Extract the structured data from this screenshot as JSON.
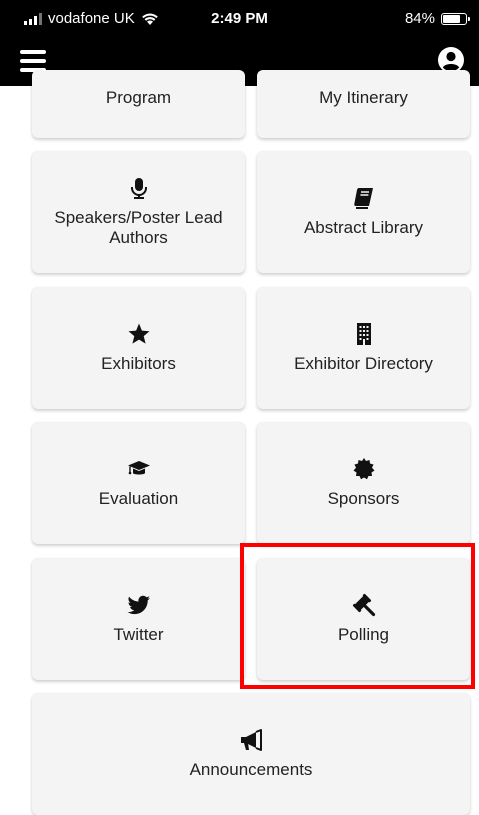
{
  "status_bar": {
    "carrier": "vodafone UK",
    "time": "2:49 PM",
    "battery": "84%",
    "battery_level": 0.84
  },
  "nav": {
    "menu_icon": "hamburger-menu-icon",
    "profile_icon": "user-circle-icon"
  },
  "tiles": [
    {
      "label": "Program",
      "icon": "calendar-icon"
    },
    {
      "label": "My Itinerary",
      "icon": "list-icon"
    },
    {
      "label": "Speakers/Poster Lead Authors",
      "icon": "microphone-icon"
    },
    {
      "label": "Abstract Library",
      "icon": "book-icon"
    },
    {
      "label": "Exhibitors",
      "icon": "star-icon"
    },
    {
      "label": "Exhibitor Directory",
      "icon": "building-icon"
    },
    {
      "label": "Evaluation",
      "icon": "graduation-cap-icon"
    },
    {
      "label": "Sponsors",
      "icon": "certificate-icon"
    },
    {
      "label": "Twitter",
      "icon": "twitter-icon"
    },
    {
      "label": "Polling",
      "icon": "gavel-icon"
    },
    {
      "label": "Announcements",
      "icon": "megaphone-icon"
    }
  ],
  "highlight_color": "#ff0000"
}
